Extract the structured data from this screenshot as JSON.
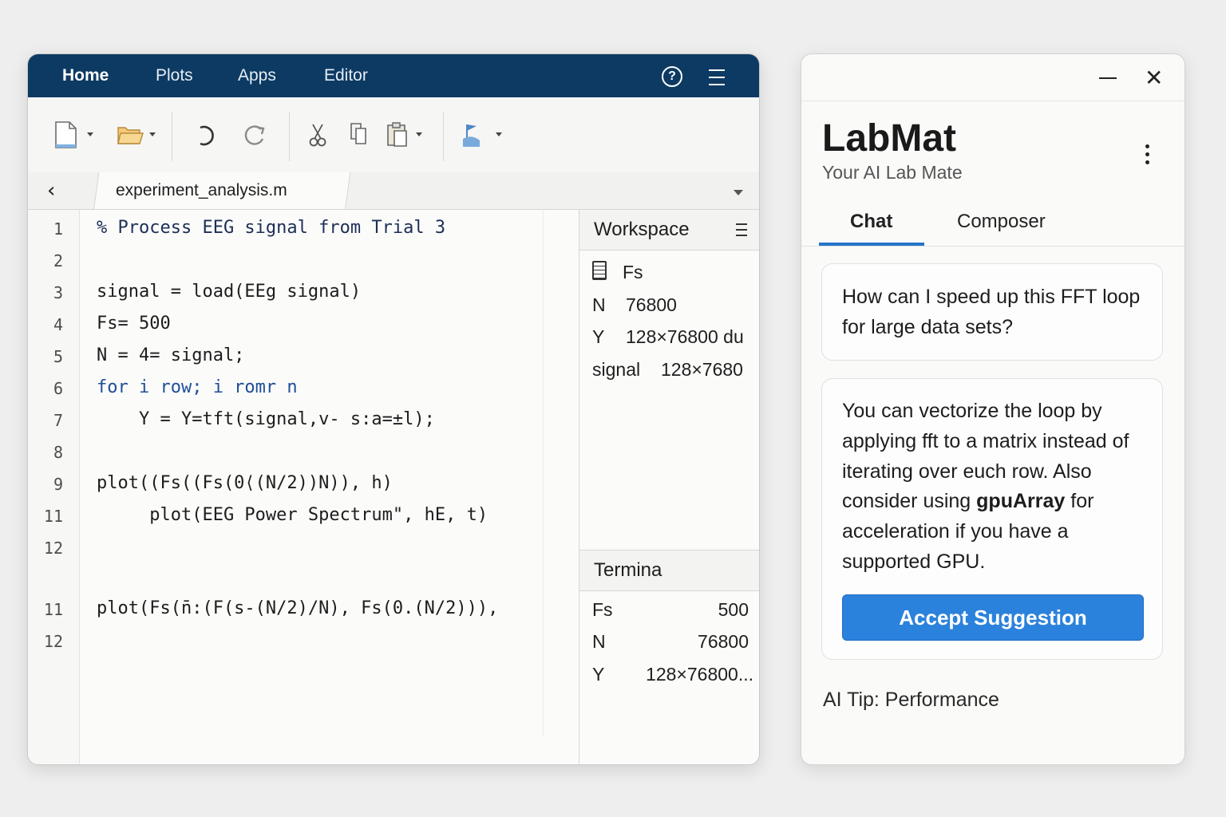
{
  "ide": {
    "menu": [
      "Home",
      "Plots",
      "Apps",
      "Editor"
    ],
    "help_label": "?",
    "file_tab": "experiment_analysis.m",
    "gutter": [
      "1",
      "2",
      "3",
      "4",
      "5",
      "6",
      "7",
      "8",
      "9",
      "11",
      "12",
      "11",
      "12"
    ],
    "code": [
      "% Process EEG signal from Trial 3",
      "",
      "signal = load(EEg signal)",
      "Fs= 500",
      "N = 4= signal;",
      "for i row; i romr n",
      "    Y = Y=tft(signal,v- s:a=±l);",
      "",
      "plot((Fs((Fs(0⟨(N/2))N)), h)",
      "     plot(EEG Power Spectrum\", hE, t)",
      "",
      "plot(Fs(n̄:(F(s-(N/2)/N), Fs(0.(N/2))),",
      ""
    ],
    "workspace": {
      "title": "Workspace",
      "rows": [
        {
          "name": "Fs",
          "value": ""
        },
        {
          "name": "N",
          "value": "76800"
        },
        {
          "name": "Y",
          "value": "128×76800 du"
        },
        {
          "name": "signal",
          "value": "128×7680"
        }
      ]
    },
    "terminal": {
      "title": "Termina",
      "rows": [
        {
          "name": "Fs",
          "value": "500"
        },
        {
          "name": "N",
          "value": "76800"
        },
        {
          "name": "Y",
          "value": "128×76800..."
        }
      ]
    }
  },
  "assistant": {
    "brand": "LabMat",
    "tagline": "Your AI Lab Mate",
    "close_glyph": "✕",
    "tabs": [
      "Chat",
      "Composer"
    ],
    "question": "How can I speed up this FFT loop for large data sets?",
    "answer_before": "You can vectorize the loop by applying fft to a matrix instead of iterating over euch row. Also consider using ",
    "answer_bold": "gpuArray",
    "answer_after": " for acceleration if you have a supported GPU.",
    "accept_label": "Accept Suggestion",
    "tip": "AI Tip: Performance"
  },
  "colors": {
    "menubar": "#0d3a63",
    "accent": "#2b82dc",
    "keyword": "#1f4e99"
  }
}
